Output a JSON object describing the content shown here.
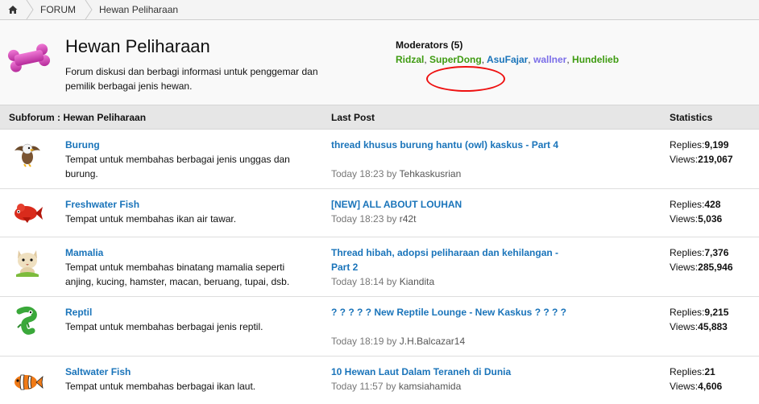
{
  "breadcrumb": {
    "items": [
      {
        "label": "FORUM"
      },
      {
        "label": "Hewan Peliharaan"
      }
    ]
  },
  "header": {
    "title": "Hewan Peliharaan",
    "description": "Forum diskusi dan berbagi informasi untuk penggemar dan pemilik berbagai jenis hewan.",
    "moderators_label": "Moderators (5)",
    "moderators": [
      {
        "name": "Ridzal",
        "color": "#3e9b11"
      },
      {
        "name": "SuperDong",
        "color": "#3e9b11"
      },
      {
        "name": "AsuFajar",
        "color": "#1a74ba"
      },
      {
        "name": "wallner",
        "color": "#7b6ee8"
      },
      {
        "name": "Hundelieb",
        "color": "#3e9b11"
      }
    ],
    "separator": ","
  },
  "table": {
    "columns": [
      "Subforum : Hewan Peliharaan",
      "Last Post",
      "Statistics"
    ],
    "replies_label": "Replies:",
    "views_label": "Views:",
    "by_label": "by",
    "rows": [
      {
        "icon": "eagle-icon",
        "title": "Burung",
        "description": "Tempat untuk membahas berbagai jenis unggas dan burung.",
        "last_post_title": "thread khusus burung hantu (owl) kaskus - Part 4",
        "last_post_time": "Today 18:23",
        "last_post_user": "Tehkaskusrian",
        "replies": "9,199",
        "views": "219,067"
      },
      {
        "icon": "fish-icon",
        "title": "Freshwater Fish",
        "description": "Tempat untuk membahas ikan air tawar.",
        "last_post_title": "[NEW] ALL ABOUT LOUHAN",
        "last_post_time": "Today 18:23",
        "last_post_user": "r42t",
        "replies": "428",
        "views": "5,036"
      },
      {
        "icon": "cat-icon",
        "title": "Mamalia",
        "description": "Tempat untuk membahas binatang mamalia seperti anjing, kucing, hamster, macan, beruang, tupai, dsb.",
        "last_post_title": "Thread hibah, adopsi peliharaan dan kehilangan - Part 2",
        "last_post_time": "Today 18:14",
        "last_post_user": "Kiandita",
        "replies": "7,376",
        "views": "285,946"
      },
      {
        "icon": "chameleon-icon",
        "title": "Reptil",
        "description": "Tempat untuk membahas berbagai jenis reptil.",
        "last_post_title": "? ? ? ? ? New Reptile Lounge - New Kaskus ? ? ? ?",
        "last_post_time": "Today 18:19",
        "last_post_user": "J.H.Balcazar14",
        "replies": "9,215",
        "views": "45,883"
      },
      {
        "icon": "clownfish-icon",
        "title": "Saltwater Fish",
        "description": "Tempat untuk membahas berbagai ikan laut.",
        "last_post_title": "10 Hewan Laut Dalam Teraneh di Dunia",
        "last_post_time": "Today 11:57",
        "last_post_user": "kamsiahamida",
        "replies": "21",
        "views": "4,606"
      }
    ]
  }
}
